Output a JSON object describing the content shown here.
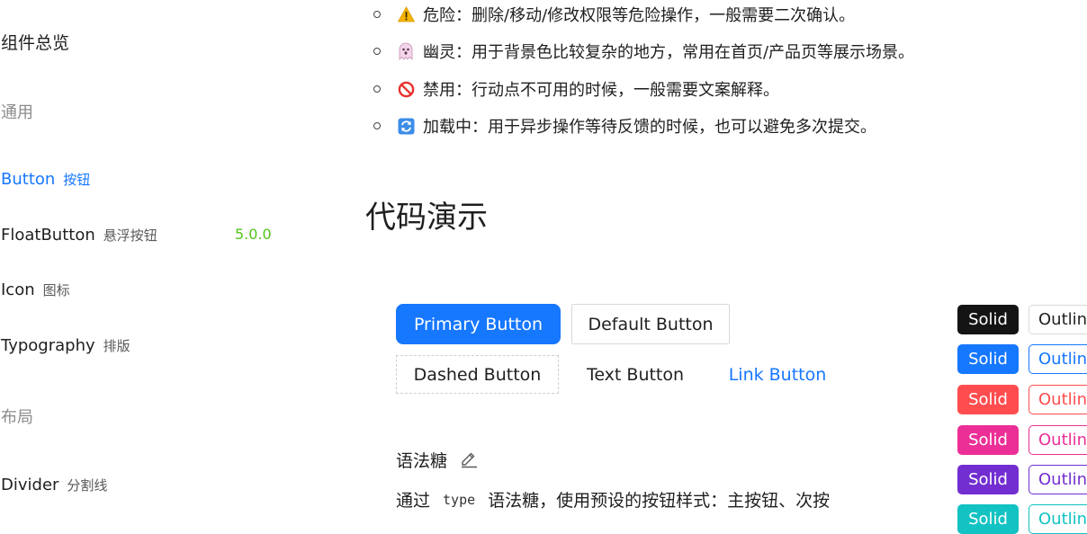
{
  "sidebar": {
    "title": "组件总览",
    "groups": {
      "general": "通用",
      "layout": "布局"
    },
    "items": [
      {
        "en": "Button",
        "zh": "按钮"
      },
      {
        "en": "FloatButton",
        "zh": "悬浮按钮",
        "badge": "5.0.0"
      },
      {
        "en": "Icon",
        "zh": "图标"
      },
      {
        "en": "Typography",
        "zh": "排版"
      },
      {
        "en": "Divider",
        "zh": "分割线"
      }
    ]
  },
  "bullets": [
    {
      "icon": "warning-icon",
      "text": "危险：删除/移动/修改权限等危险操作，一般需要二次确认。"
    },
    {
      "icon": "ghost-icon",
      "text": "幽灵：用于背景色比较复杂的地方，常用在首页/产品页等展示场景。"
    },
    {
      "icon": "prohibited-icon",
      "text": "禁用：行动点不可用的时候，一般需要文案解释。"
    },
    {
      "icon": "refresh-icon",
      "text": "加载中：用于异步操作等待反馈的时候，也可以避免多次提交。"
    }
  ],
  "section_heading": "代码演示",
  "demo_buttons": {
    "primary": "Primary Button",
    "default": "Default Button",
    "dashed": "Dashed Button",
    "text": "Text Button",
    "link": "Link Button"
  },
  "variants": {
    "solid_label": "Solid",
    "outline_label": "Outlin",
    "colors": [
      "#141414",
      "#1677ff",
      "#ff4d4f",
      "#eb2f96",
      "#722ed1",
      "#13c2c2"
    ]
  },
  "syntax_sugar": {
    "title": "语法糖",
    "desc_prefix": "通过",
    "code": "type",
    "desc_suffix": "语法糖，使用预设的按钮样式：主按钮、次按"
  }
}
